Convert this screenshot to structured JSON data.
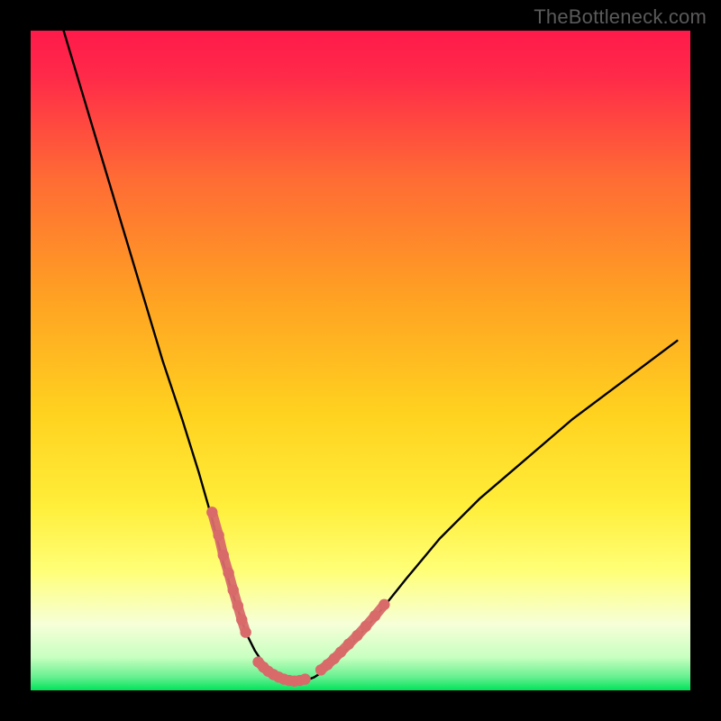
{
  "attribution": "TheBottleneck.com",
  "colors": {
    "frame": "#000000",
    "gradient_top": "#ff1a4b",
    "gradient_mid1": "#ff7a2e",
    "gradient_mid2": "#ffd21f",
    "gradient_mid3": "#ffff66",
    "gradient_mid4": "#f3ffd0",
    "gradient_bottom": "#00e35a",
    "curve": "#000000",
    "dots": "#d86a6a",
    "attribution_text": "#5a5a5a"
  },
  "chart_data": {
    "type": "line",
    "title": "",
    "xlabel": "",
    "ylabel": "",
    "xlim": [
      0,
      100
    ],
    "ylim": [
      0,
      100
    ],
    "series": [
      {
        "name": "bottleneck-curve",
        "x": [
          5,
          8,
          11,
          14,
          17,
          20,
          23,
          25.5,
          27.5,
          29,
          30.5,
          32,
          33,
          34,
          35,
          36,
          37,
          38,
          39,
          40,
          41.5,
          43,
          45,
          47,
          50,
          53,
          57,
          62,
          68,
          75,
          82,
          90,
          98
        ],
        "y": [
          100,
          90,
          80,
          70,
          60,
          50,
          41,
          33,
          26,
          20,
          15,
          10.5,
          8,
          6,
          4.5,
          3.2,
          2.4,
          1.8,
          1.4,
          1.2,
          1.4,
          2.0,
          3.3,
          5.2,
          8.5,
          12,
          17,
          23,
          29,
          35,
          41,
          47,
          53
        ]
      },
      {
        "name": "highlight-cluster-left",
        "x": [
          27.5,
          28.5,
          29.2,
          30.0,
          30.7,
          31.4,
          32.0,
          32.6
        ],
        "y": [
          27,
          23.5,
          20.5,
          17.8,
          15.2,
          12.8,
          10.7,
          8.8
        ]
      },
      {
        "name": "highlight-cluster-valley",
        "x": [
          34.5,
          35.3,
          36.0,
          36.8,
          37.6,
          38.4,
          39.2,
          40.0,
          40.8,
          41.6
        ],
        "y": [
          4.3,
          3.5,
          2.9,
          2.4,
          2.0,
          1.7,
          1.5,
          1.4,
          1.5,
          1.7
        ]
      },
      {
        "name": "highlight-cluster-right",
        "x": [
          44.0,
          45.0,
          46.0,
          47.0,
          48.2,
          49.5,
          50.8,
          52.2,
          53.6
        ],
        "y": [
          3.1,
          3.9,
          4.8,
          5.8,
          7.0,
          8.3,
          9.7,
          11.3,
          13.0
        ]
      }
    ],
    "gradient_bands": [
      {
        "y": 100,
        "color": "#ff1a4b"
      },
      {
        "y": 55,
        "color": "#ff9a2a"
      },
      {
        "y": 30,
        "color": "#ffe81f"
      },
      {
        "y": 15,
        "color": "#ffff80"
      },
      {
        "y": 8,
        "color": "#f6ffe0"
      },
      {
        "y": 0,
        "color": "#00e35a"
      }
    ]
  }
}
